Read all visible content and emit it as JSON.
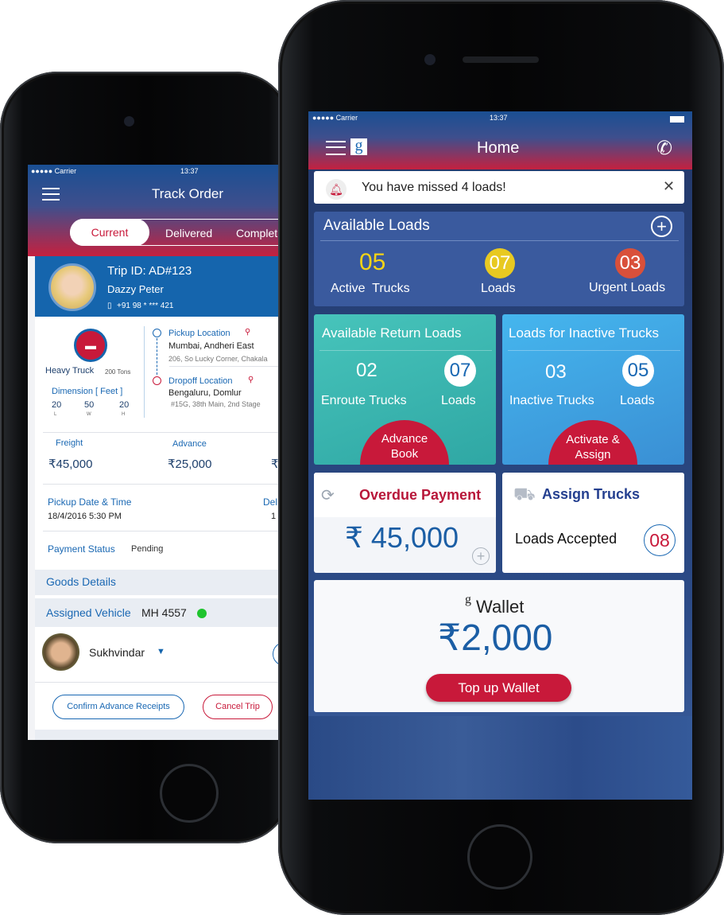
{
  "back_phone": {
    "status": {
      "carrier": "●●●●● Carrier",
      "time": "13:37"
    },
    "title": "Track Order",
    "tabs": [
      {
        "label": "Current",
        "active": true
      },
      {
        "label": "Delivered"
      },
      {
        "label": "Complet"
      }
    ],
    "trip": {
      "id": "Trip ID: AD#123",
      "name": "Dazzy Peter",
      "phone": "+91 98 * *** 421"
    },
    "truck": {
      "type": "Heavy Truck",
      "capacity": "200 Tons",
      "dimension_label": "Dimension [ Feet ]",
      "dims": [
        {
          "v": "20",
          "k": "L"
        },
        {
          "v": "50",
          "k": "W"
        },
        {
          "v": "20",
          "k": "H"
        }
      ]
    },
    "pickup": {
      "label": "Pickup Location",
      "city": "Mumbai, Andheri East",
      "address": "206, So Lucky Corner, Chakala"
    },
    "dropoff": {
      "label": "Dropoff Location",
      "city": "Bengaluru, Domlur",
      "address": "#15G, 38th Main, 2nd Stage"
    },
    "freight": {
      "label": "Freight",
      "value": "₹45,000"
    },
    "advance": {
      "label": "Advance",
      "value": "₹25,000"
    },
    "balance_partial": "₹",
    "pickup_time": {
      "label": "Pickup Date & Time",
      "value": "18/4/2016 5:30 PM"
    },
    "delivery_partial": {
      "label": "Del",
      "value": "1"
    },
    "payment": {
      "label": "Payment Status",
      "value": "Pending"
    },
    "goods_label": "Goods Details",
    "vehicle": {
      "label": "Assigned Vehicle",
      "number": "MH 4557",
      "status_color": "#1fc42e"
    },
    "driver": "Sukhvindar",
    "buttons": {
      "confirm": "Confirm Advance Receipts",
      "cancel": "Cancel Trip"
    }
  },
  "front_phone": {
    "status": {
      "carrier": "●●●●● Carrier",
      "time": "13:37"
    },
    "title": "Home",
    "logo": "g",
    "notification": "You have missed 4 loads!",
    "available": {
      "title": "Available Loads",
      "active_trucks": "05",
      "active_label": "Active  Trucks",
      "loads": "07",
      "loads_label": "Loads",
      "urgent": "03",
      "urgent_label": "Urgent Loads"
    },
    "return_loads": {
      "title": "Available Return Loads",
      "trucks": "02",
      "trucks_label": "Enroute Trucks",
      "loads": "07",
      "loads_label": "Loads",
      "action_1": "Advance",
      "action_2": "Book"
    },
    "inactive": {
      "title": "Loads for Inactive Trucks",
      "trucks": "03",
      "trucks_label": "Inactive Trucks",
      "loads": "05",
      "loads_label": "Loads",
      "action_1": "Activate &",
      "action_2": "Assign"
    },
    "overdue": {
      "title": "Overdue Payment",
      "amount": "₹ 45,000"
    },
    "assign": {
      "title": "Assign Trucks",
      "label": "Loads Accepted",
      "count": "08"
    },
    "wallet": {
      "logo": "g",
      "title": "Wallet",
      "amount": "₹2,000",
      "button": "Top up Wallet"
    }
  },
  "colors": {
    "red": "#c8193a",
    "blue": "#1a68b3",
    "card_blue": "#3a5a9e",
    "yellow": "#e8c921",
    "urgent": "#d9503a",
    "teal": "#35b5ad",
    "sky": "#3aa3e3"
  }
}
